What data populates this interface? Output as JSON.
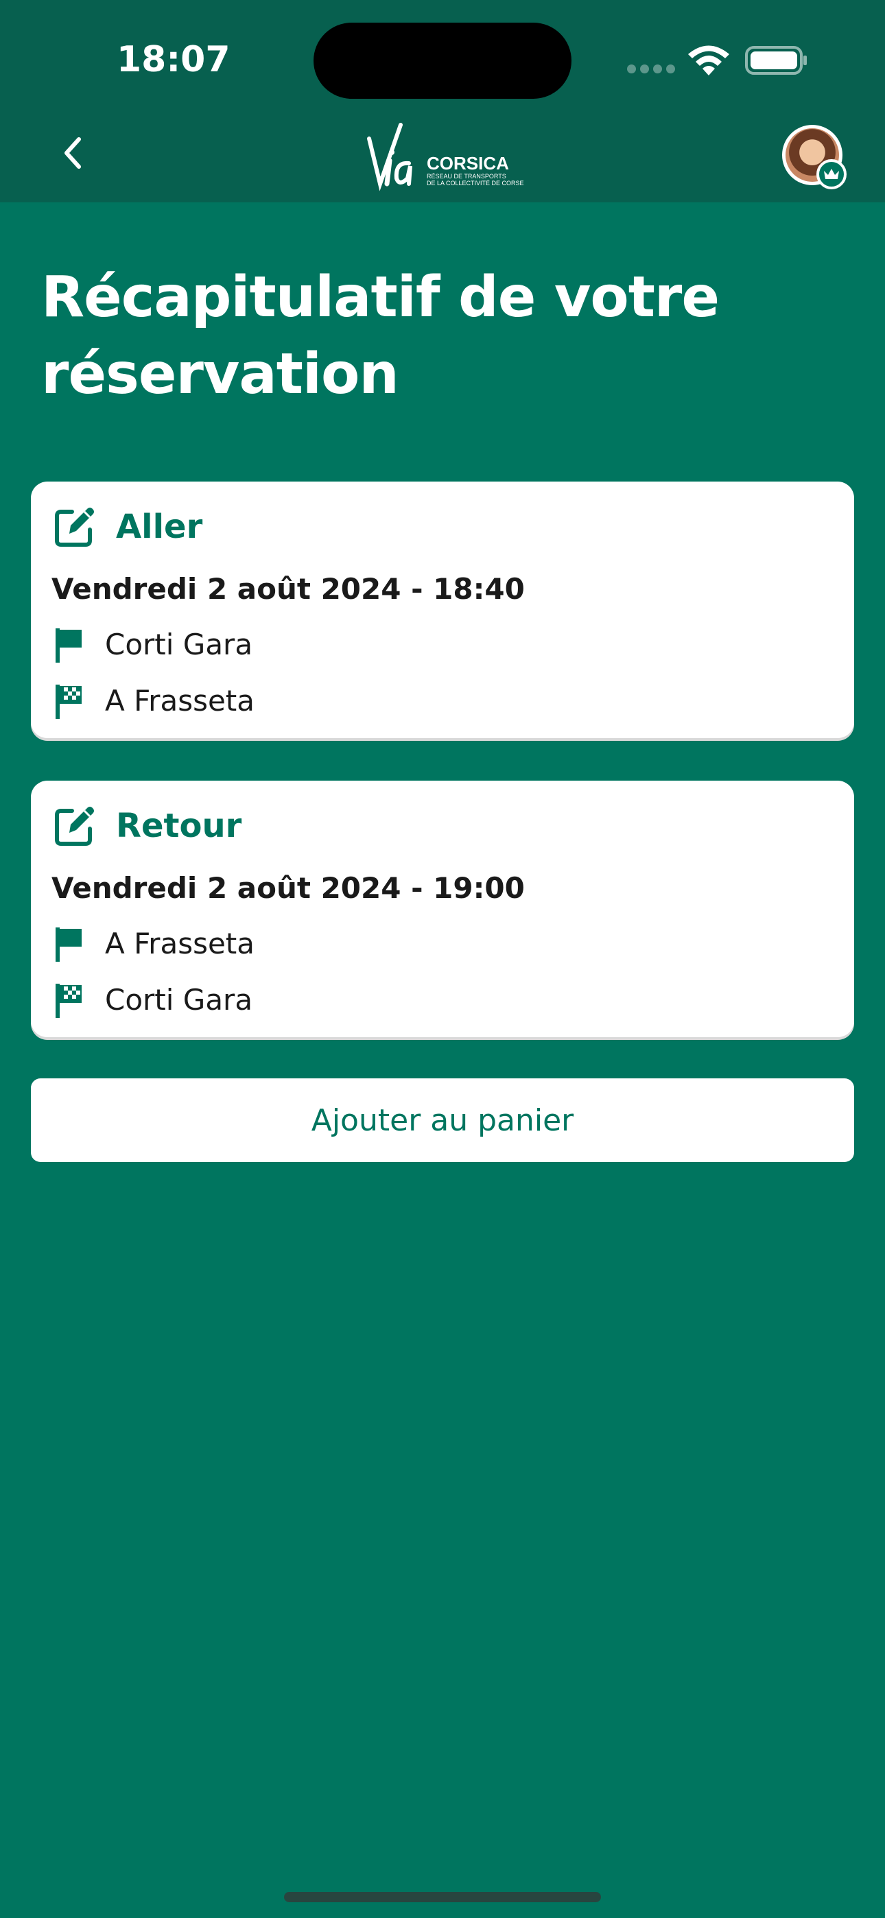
{
  "status_bar": {
    "time": "18:07"
  },
  "nav": {
    "back_icon": "chevron-left-icon",
    "logo": {
      "brand": "CORSICA",
      "tagline_line1": "RÉSEAU DE TRANSPORTS",
      "tagline_line2": "DE LA COLLECTIVITÉ DE CORSE"
    },
    "avatar_badge_icon": "crown-icon"
  },
  "page": {
    "title": "Récapitulatif de votre réservation"
  },
  "trips": [
    {
      "title": "Aller",
      "edit_icon": "edit-icon",
      "date": "Vendredi 2 août 2024 - 18:40",
      "from": "Corti Gara",
      "to": "A Frasseta"
    },
    {
      "title": "Retour",
      "edit_icon": "edit-icon",
      "date": "Vendredi 2 août 2024 - 19:00",
      "from": "A Frasseta",
      "to": "Corti Gara"
    }
  ],
  "actions": {
    "add_to_cart": "Ajouter au panier"
  },
  "colors": {
    "header_bg": "#07604f",
    "page_bg": "#00755f",
    "accent": "#00755f",
    "card_bg": "#ffffff"
  }
}
